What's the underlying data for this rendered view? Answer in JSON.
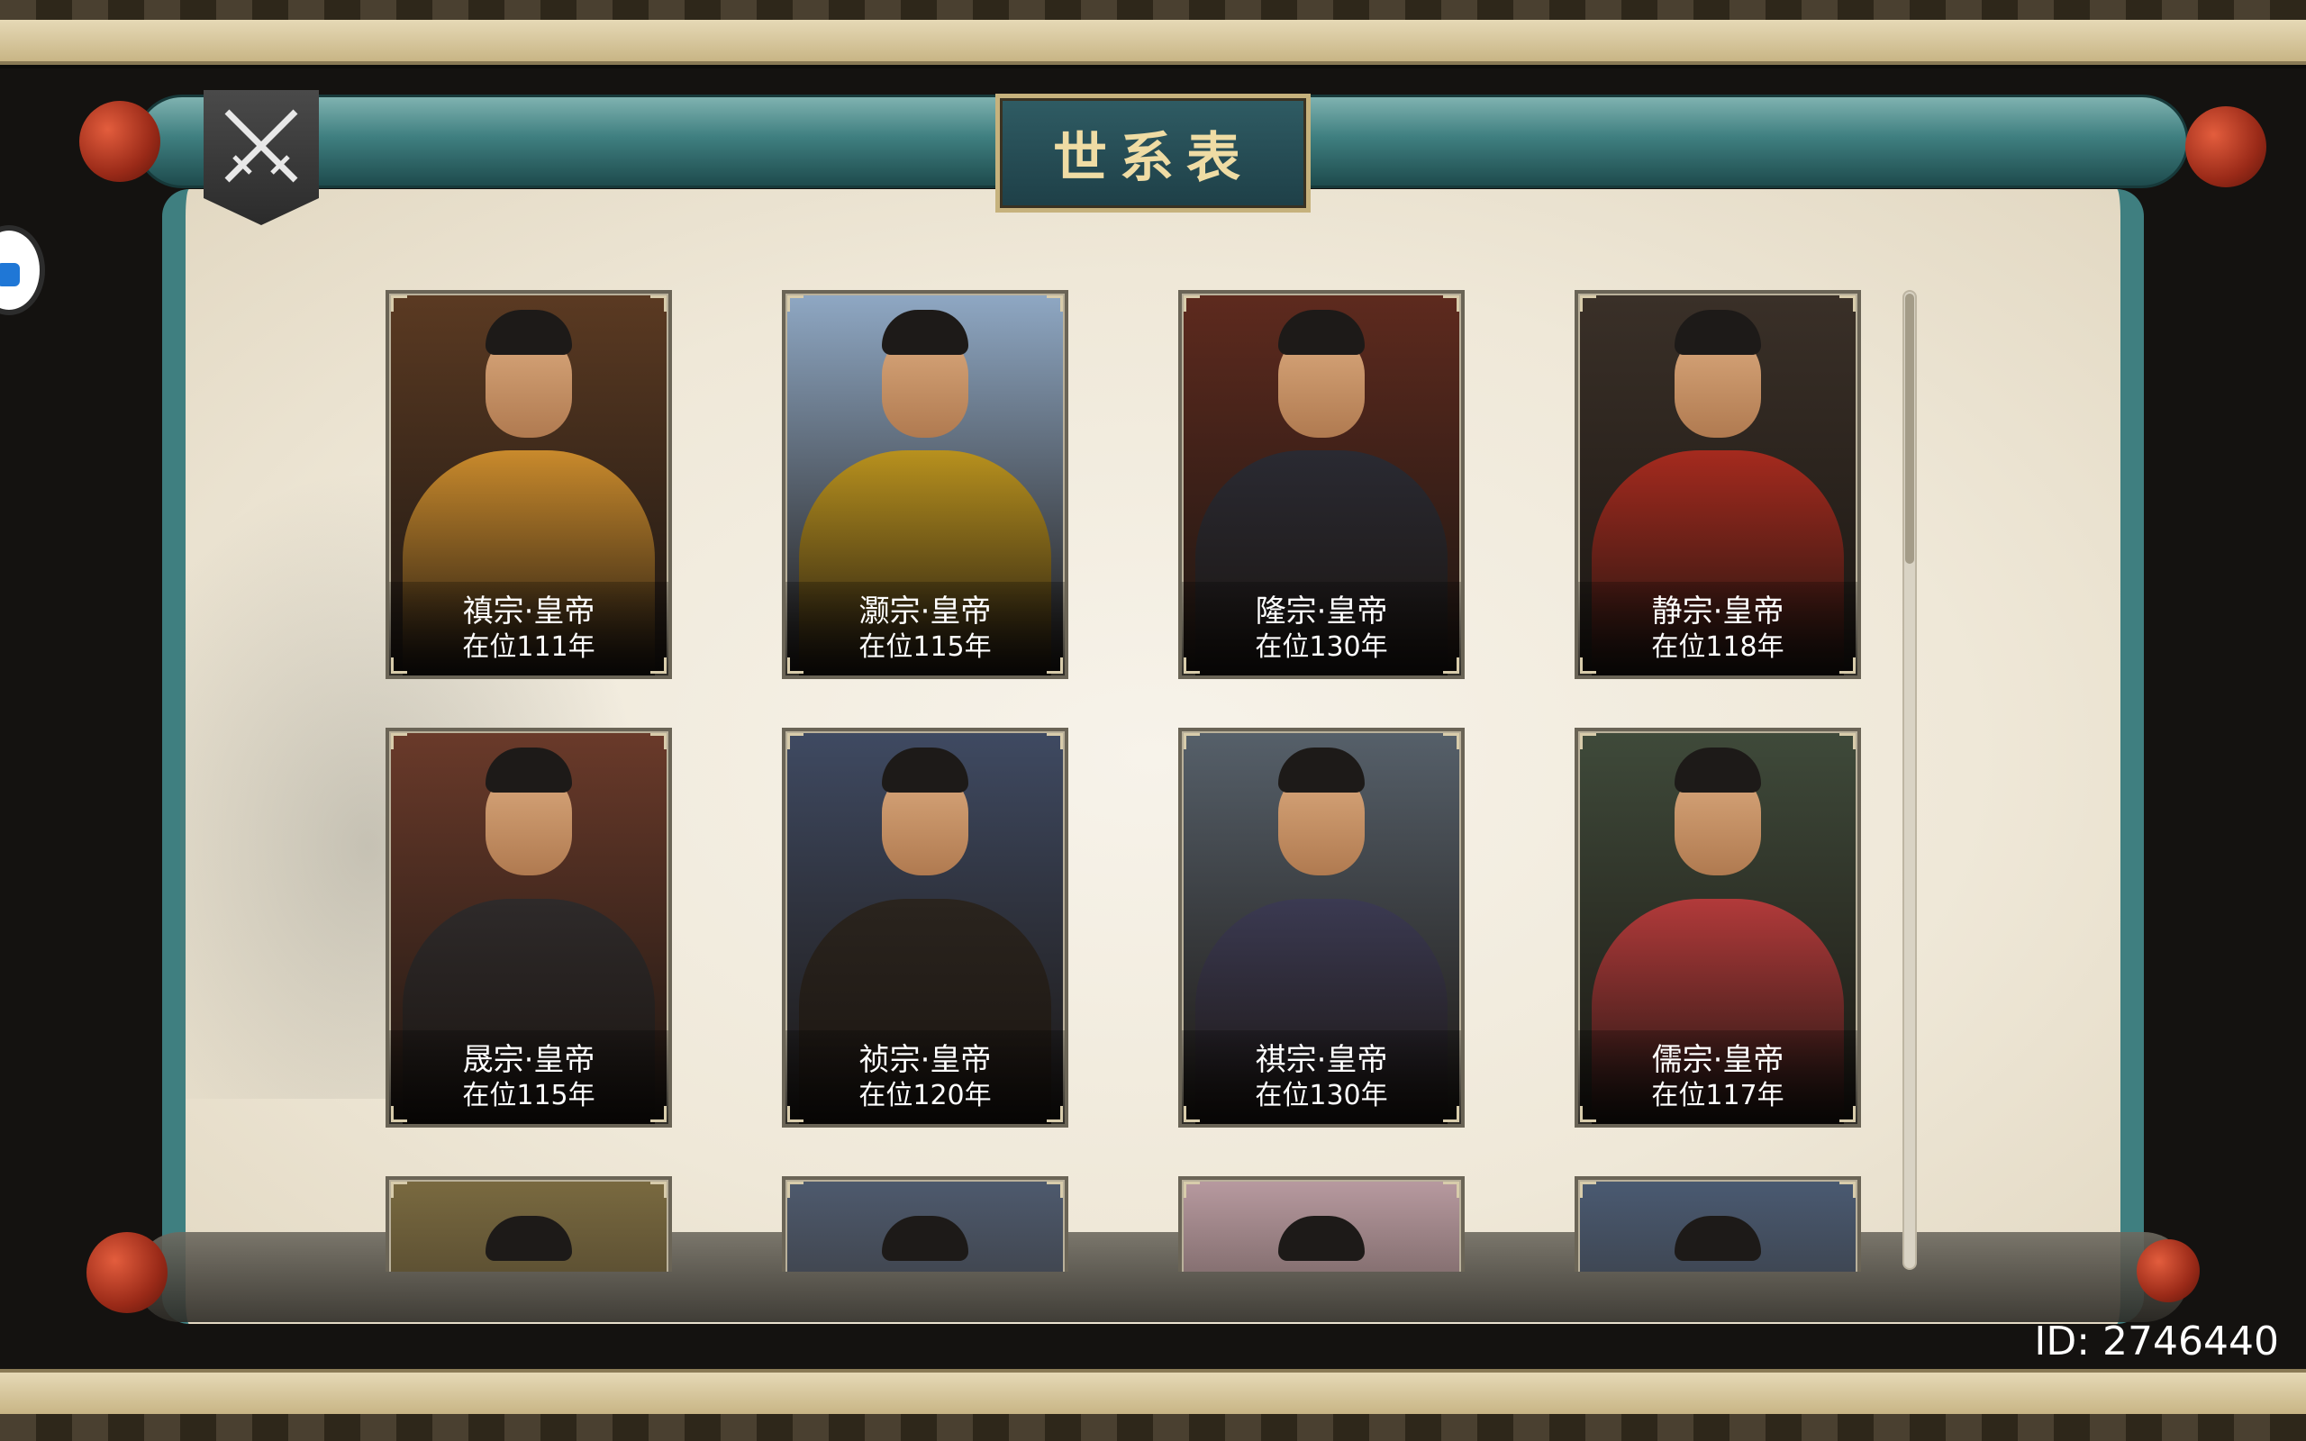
{
  "title": "世系表",
  "close_button": {
    "icon": "crossed-swords-icon"
  },
  "player": {
    "id_label": "ID: 2746440"
  },
  "colors": {
    "scroll_teal": "#3f7f80",
    "paper": "#f4efe3",
    "knob": "#b03a22",
    "plaque_border": "#c6b27d"
  },
  "rulers": [
    {
      "name": "禛宗·皇帝",
      "reign": "在位111年",
      "bg": "#5b3a22",
      "robe": "#c98a2c"
    },
    {
      "name": "灏宗·皇帝",
      "reign": "在位115年",
      "bg": "#8fa8c4",
      "robe": "#b8911e"
    },
    {
      "name": "隆宗·皇帝",
      "reign": "在位130年",
      "bg": "#5e2a1e",
      "robe": "#2a2a32"
    },
    {
      "name": "静宗·皇帝",
      "reign": "在位118年",
      "bg": "#3a3028",
      "robe": "#a52a1e"
    },
    {
      "name": "晟宗·皇帝",
      "reign": "在位115年",
      "bg": "#6a3a2a",
      "robe": "#2e2a2a"
    },
    {
      "name": "祯宗·皇帝",
      "reign": "在位120年",
      "bg": "#3f4a62",
      "robe": "#2a241e"
    },
    {
      "name": "祺宗·皇帝",
      "reign": "在位130年",
      "bg": "#56606a",
      "robe": "#3b3a52"
    },
    {
      "name": "儒宗·皇帝",
      "reign": "在位117年",
      "bg": "#3f4a3a",
      "robe": "#b23a3a"
    }
  ],
  "partial_rulers": [
    {
      "bg": "#7a6a40"
    },
    {
      "bg": "#4e5a6e"
    },
    {
      "bg": "#b89aa0"
    },
    {
      "bg": "#4a5a72"
    }
  ]
}
